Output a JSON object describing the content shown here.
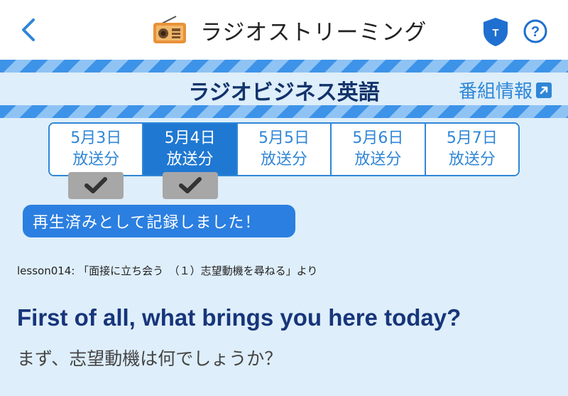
{
  "header": {
    "title": "ラジオストリーミング",
    "shield_letter": "T",
    "help_symbol": "?",
    "icons": {
      "back": "chevron-left-icon",
      "radio": "radio-icon",
      "shield": "shield-icon",
      "help": "help-icon"
    }
  },
  "program": {
    "title": "ラジオビジネス英語",
    "info_link": "番組情報"
  },
  "date_tabs": [
    {
      "date": "5月3日",
      "label": "放送分",
      "active": false,
      "played": true
    },
    {
      "date": "5月4日",
      "label": "放送分",
      "active": true,
      "played": true
    },
    {
      "date": "5月5日",
      "label": "放送分",
      "active": false,
      "played": false
    },
    {
      "date": "5月6日",
      "label": "放送分",
      "active": false,
      "played": false
    },
    {
      "date": "5月7日",
      "label": "放送分",
      "active": false,
      "played": false
    }
  ],
  "toast": "再生済みとして記録しました！",
  "lesson": {
    "source": "lesson014: 「面接に立ち会う　（１）志望動機を尋ねる」より",
    "english": "First of all, what brings you here today?",
    "japanese": "まず、志望動機は何でしょうか？"
  },
  "colors": {
    "accent": "#2f86d6",
    "active_tab": "#1f78d2",
    "title_navy": "#12336b",
    "background": "#deeefa",
    "badge_gray": "#a7a7a7"
  }
}
